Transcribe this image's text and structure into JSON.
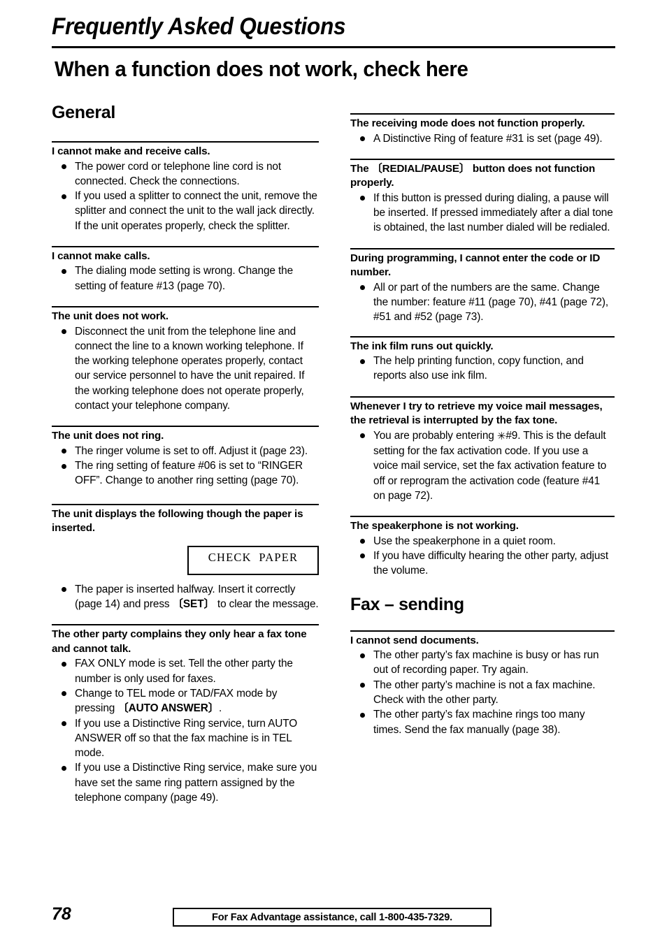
{
  "header": {
    "running_head": "Frequently Asked Questions",
    "page_title": "When a function does not work, check here"
  },
  "left_column": {
    "section_title": "General",
    "blocks": [
      {
        "heading": "I cannot make and receive calls.",
        "bullets": [
          "The power cord or telephone line cord is not connected. Check the connections.",
          "If you used a splitter to connect the unit, remove the splitter and connect the unit to the wall jack directly. If the unit operates properly, check the splitter."
        ]
      },
      {
        "heading": "I cannot make calls.",
        "bullets": [
          "The dialing mode setting is wrong. Change the setting of feature #13 (page 70)."
        ]
      },
      {
        "heading": "The unit does not work.",
        "bullets": [
          "Disconnect the unit from the telephone line and connect the line to a known working telephone. If the working telephone operates properly, contact our service personnel to have the unit repaired. If the working telephone does not operate properly, contact your telephone company."
        ]
      },
      {
        "heading": "The unit does not ring.",
        "bullets": [
          "The ringer volume is set to off. Adjust it (page 23).",
          "The ring setting of feature #06 is set to “RINGER OFF”. Change to another ring setting (page 70)."
        ]
      },
      {
        "heading": "The unit displays the following though the paper is inserted.",
        "display_value": "CHECK  PAPER",
        "bullets_rich": [
          {
            "pre": "The paper is inserted halfway. Insert it correctly (page 14) and press ",
            "key": "〔SET〕",
            "post": " to clear the message."
          }
        ]
      },
      {
        "heading": "The other party complains they only hear a fax tone and cannot talk.",
        "bullets": [
          "FAX ONLY mode is set. Tell the other party the number is only used for faxes."
        ],
        "bullets_rich": [
          {
            "pre": "Change to TEL mode or TAD/FAX mode by pressing ",
            "key": "〔AUTO ANSWER〕",
            "post": "."
          }
        ],
        "bullets_tail": [
          "If you use a Distinctive Ring service, turn AUTO ANSWER off so that the fax machine is in TEL mode.",
          "If you use a Distinctive Ring service, make sure you have set the same ring pattern assigned by the telephone company (page 49)."
        ]
      }
    ]
  },
  "right_column": {
    "blocks": [
      {
        "heading": "The receiving mode does not function properly.",
        "bullets": [
          "A Distinctive Ring of feature #31 is set (page 49)."
        ]
      },
      {
        "heading_pre": "The ",
        "heading_key": "〔REDIAL/PAUSE〕",
        "heading_post": " button does not function properly.",
        "bullets": [
          "If this button is pressed during dialing, a pause will be inserted. If pressed immediately after a dial tone is obtained, the last number dialed will be redialed."
        ]
      },
      {
        "heading": "During programming, I cannot enter the code or ID number.",
        "bullets": [
          "All or part of the numbers are the same. Change the number: feature #11 (page 70), #41 (page 72), #51 and #52 (page 73)."
        ]
      },
      {
        "heading": "The ink film runs out quickly.",
        "bullets": [
          "The help printing function, copy function, and reports also use ink film."
        ]
      },
      {
        "heading": "Whenever I try to retrieve my voice mail messages, the retrieval is interrupted by the fax tone.",
        "bullet_star_pre": "You are probably entering ",
        "bullet_star_glyph": "✳",
        "bullet_star_post": "#9. This is the default setting for the fax activation code. If you use a voice mail service, set the fax activation feature to off or reprogram the activation code (feature #41 on page 72)."
      },
      {
        "heading": "The speakerphone is not working.",
        "bullets": [
          "Use the speakerphone in a quiet room.",
          "If you have difficulty hearing the other party, adjust the volume."
        ]
      }
    ],
    "section_title": "Fax – sending",
    "fax_block": {
      "heading": "I cannot send documents.",
      "bullets": [
        "The other party’s fax machine is busy or has run out of recording paper. Try again.",
        "The other party’s machine is not a fax machine. Check with the other party.",
        "The other party’s fax machine rings too many times. Send the fax manually (page 38)."
      ]
    }
  },
  "footer": {
    "page_number": "78",
    "notice": "For Fax Advantage assistance, call 1-800-435-7329."
  }
}
